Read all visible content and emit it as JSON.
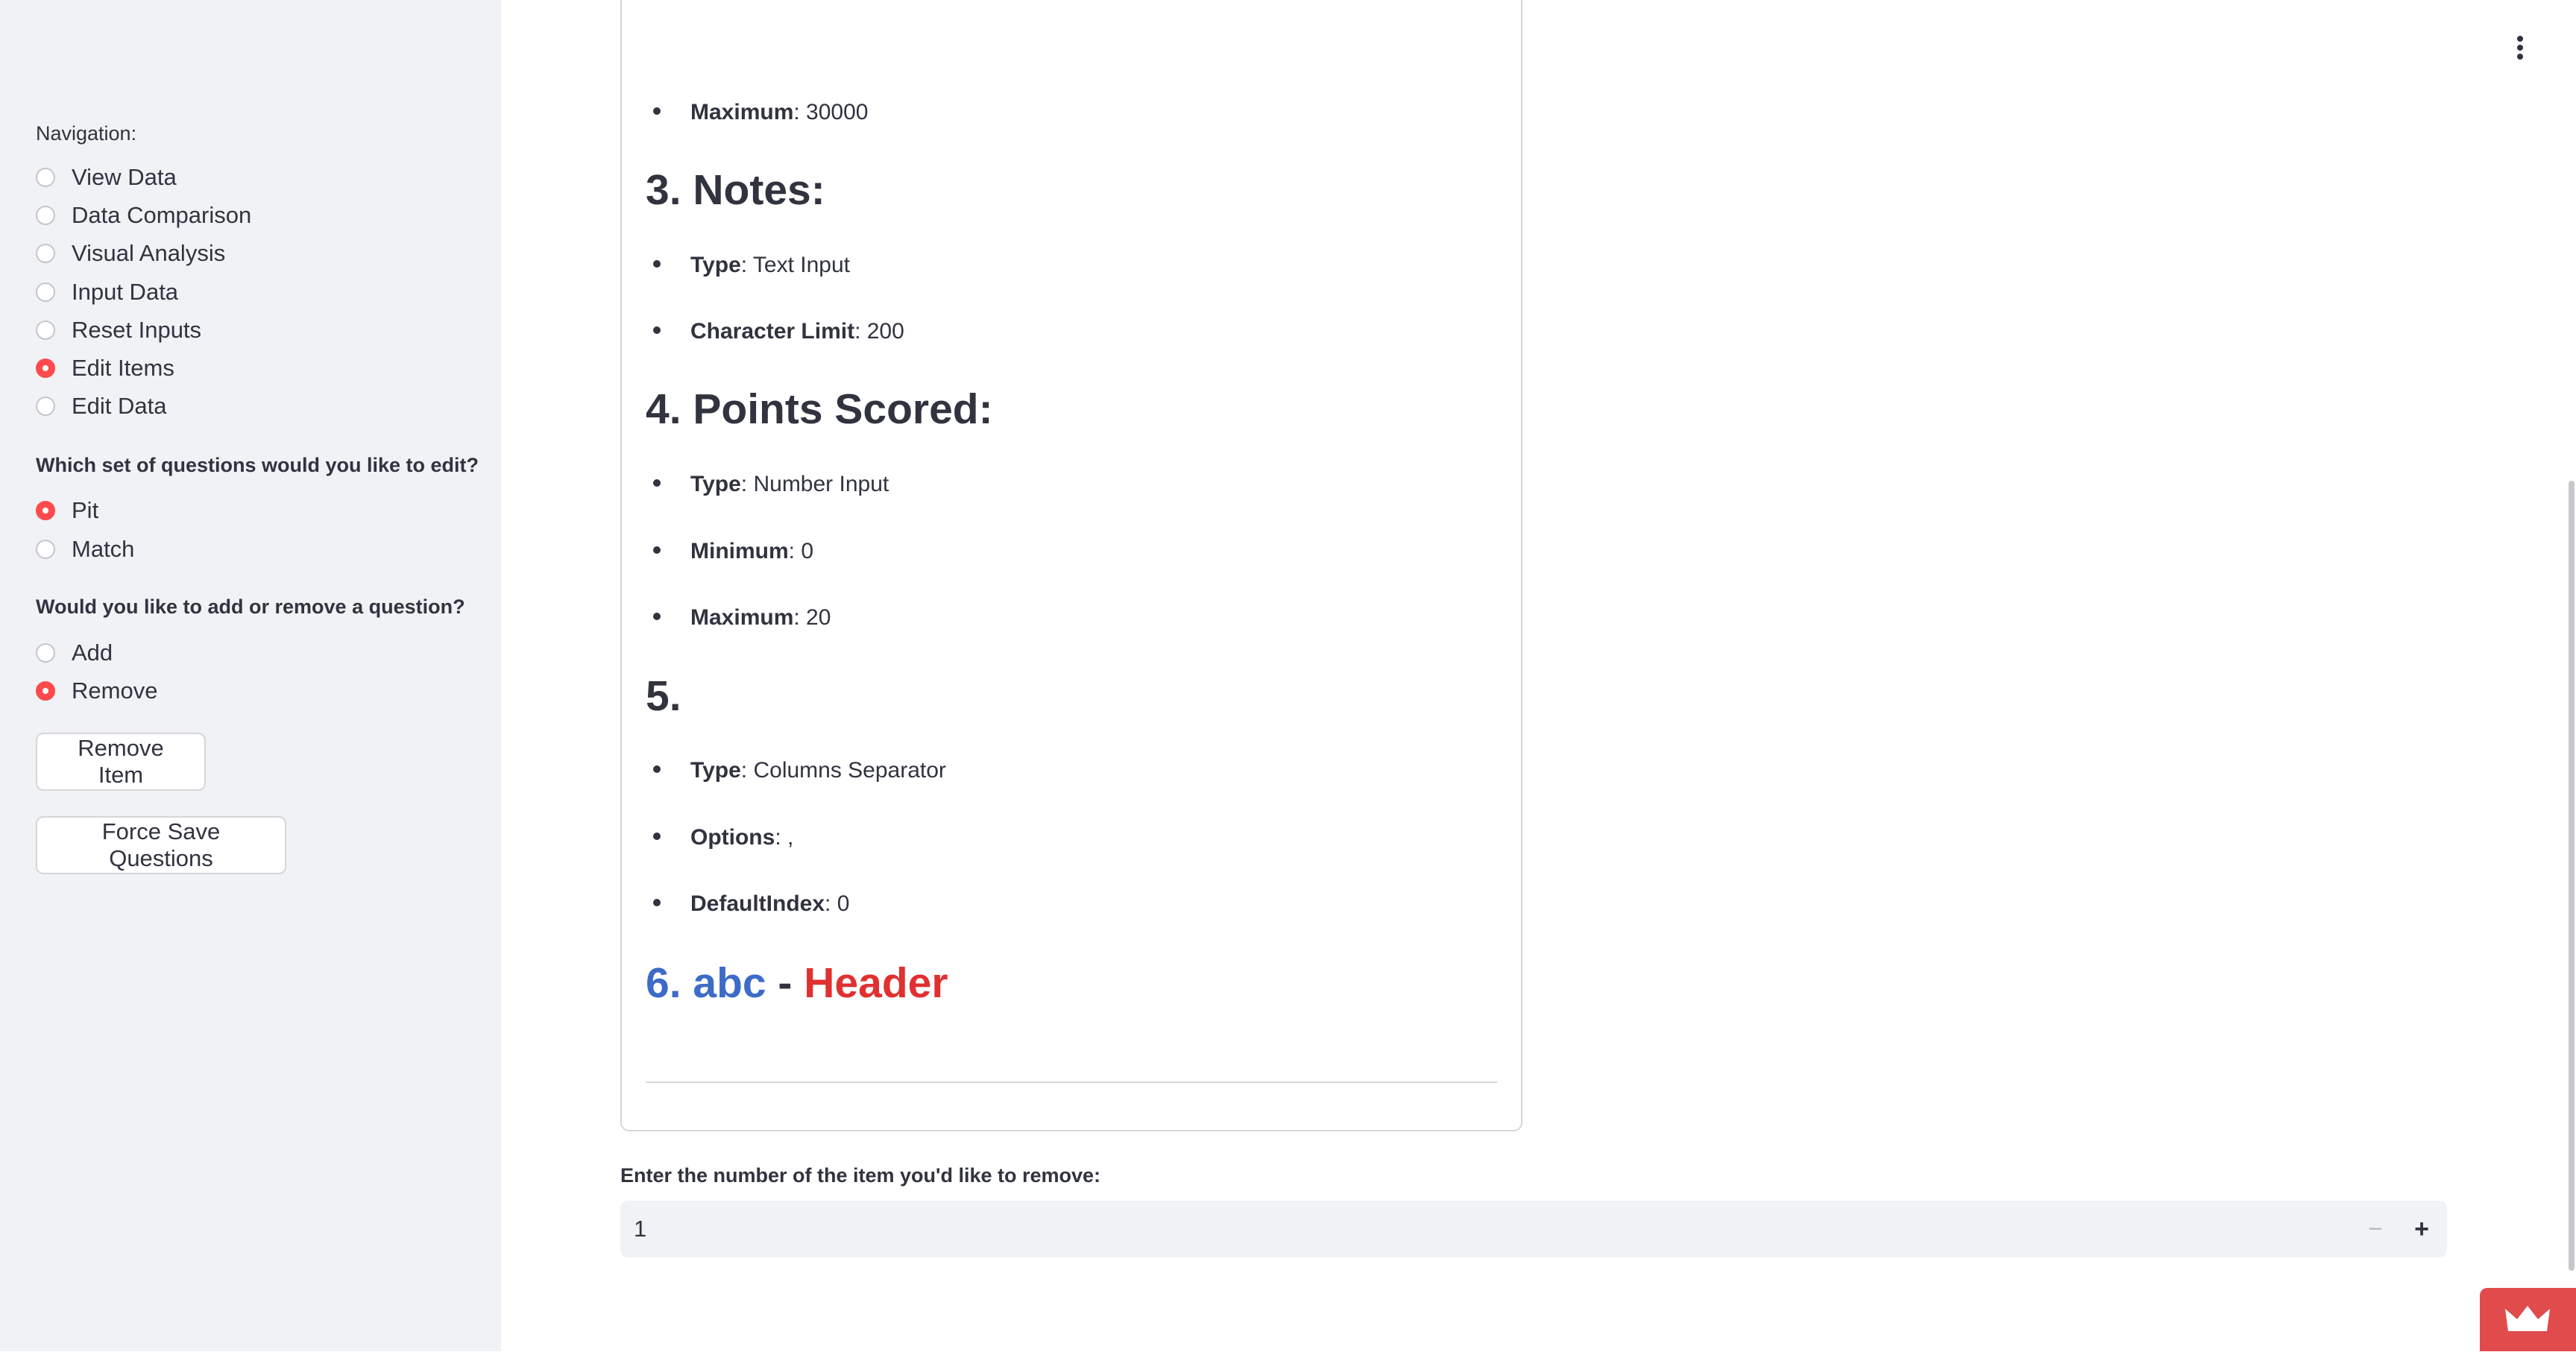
{
  "sidebar": {
    "navigation_label": "Navigation:",
    "navigation_items": [
      {
        "label": "View Data",
        "selected": false
      },
      {
        "label": "Data Comparison",
        "selected": false
      },
      {
        "label": "Visual Analysis",
        "selected": false
      },
      {
        "label": "Input Data",
        "selected": false
      },
      {
        "label": "Reset Inputs",
        "selected": false
      },
      {
        "label": "Edit Items",
        "selected": true
      },
      {
        "label": "Edit Data",
        "selected": false
      }
    ],
    "question_set_label": "Which set of questions would you like to edit?",
    "question_set_options": [
      {
        "label": "Pit",
        "selected": true
      },
      {
        "label": "Match",
        "selected": false
      }
    ],
    "action_label": "Would you like to add or remove a question?",
    "action_options": [
      {
        "label": "Add",
        "selected": false
      },
      {
        "label": "Remove",
        "selected": true
      }
    ],
    "remove_button": "Remove Item",
    "force_save_button": "Force Save Questions"
  },
  "panel": {
    "item2_maximum": {
      "key": "Maximum",
      "value": ": 30000"
    },
    "item3": {
      "heading": "3. Notes:",
      "bullets": [
        {
          "key": "Type",
          "value": ": Text Input"
        },
        {
          "key": "Character Limit",
          "value": ": 200"
        }
      ]
    },
    "item4": {
      "heading": "4. Points Scored:",
      "bullets": [
        {
          "key": "Type",
          "value": ": Number Input"
        },
        {
          "key": "Minimum",
          "value": ": 0"
        },
        {
          "key": "Maximum",
          "value": ": 20"
        }
      ]
    },
    "item5": {
      "heading": "5.",
      "bullets": [
        {
          "key": "Type",
          "value": ": Columns Separator"
        },
        {
          "key": "Options",
          "value": ": ,"
        },
        {
          "key": "DefaultIndex",
          "value": ": 0"
        }
      ]
    },
    "item6": {
      "number": "6. abc",
      "dash": " - ",
      "type": "Header",
      "number_color": "#3d6bc8",
      "type_color": "#e03030"
    }
  },
  "remove_input": {
    "label": "Enter the number of the item you'd like to remove:",
    "value": "1",
    "minus": "−",
    "plus": "+"
  },
  "colors": {
    "accent": "#ff4b4b",
    "sidebar_bg": "#f0f2f6"
  }
}
